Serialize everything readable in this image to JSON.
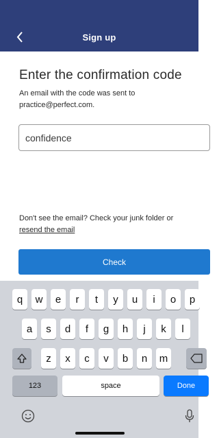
{
  "header": {
    "title": "Sign up"
  },
  "main": {
    "title": "Enter the confirmation code",
    "description": "An email with the code was sent to practice@perfect.com.",
    "code_input": {
      "value": "confidence",
      "placeholder": ""
    },
    "help_text": "Don't see the email? Check your junk folder or",
    "resend_link": "resend the email",
    "check_button": "Check"
  },
  "keyboard": {
    "row1": [
      "q",
      "w",
      "e",
      "r",
      "t",
      "y",
      "u",
      "i",
      "o",
      "p"
    ],
    "row2": [
      "a",
      "s",
      "d",
      "f",
      "g",
      "h",
      "j",
      "k",
      "l"
    ],
    "row3": [
      "z",
      "x",
      "c",
      "v",
      "b",
      "n",
      "m"
    ],
    "numbers_key": "123",
    "space_key": "space",
    "done_key": "Done",
    "icons": {
      "shift": "shift-icon",
      "backspace": "backspace-icon",
      "emoji": "emoji-icon",
      "mic": "microphone-icon",
      "back": "chevron-left-icon"
    }
  },
  "colors": {
    "header": "#2e3f7a",
    "button": "#1f79cf",
    "done": "#0a7aff",
    "keyboard_bg": "#d1d4da"
  }
}
